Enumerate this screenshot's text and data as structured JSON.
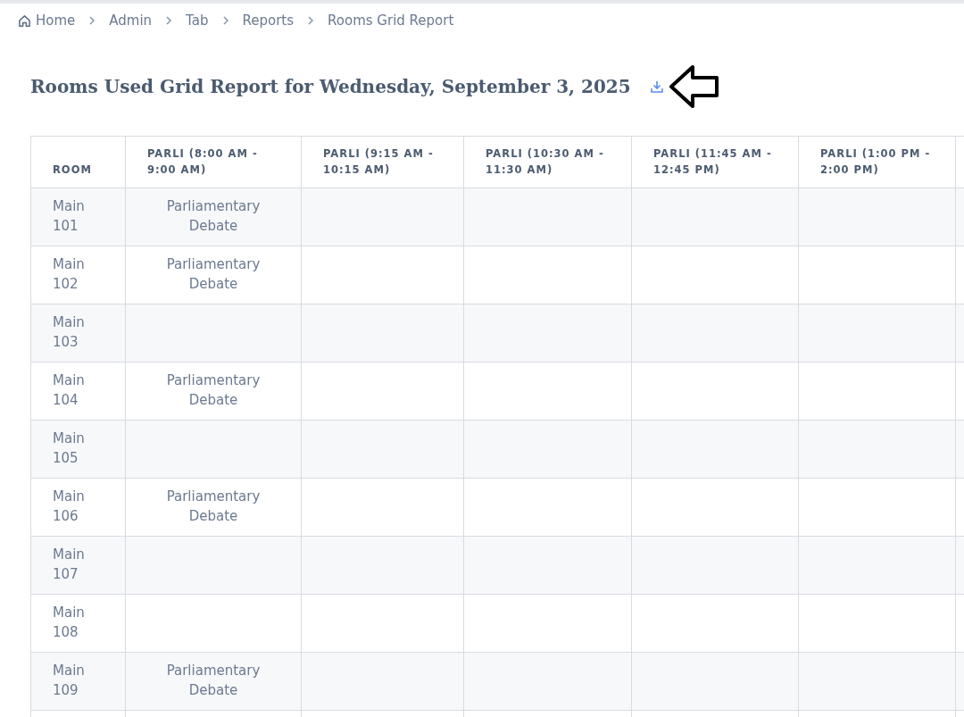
{
  "breadcrumb": [
    {
      "label": "Home",
      "kind": "home"
    },
    {
      "label": "Admin",
      "kind": "link"
    },
    {
      "label": "Tab",
      "kind": "link"
    },
    {
      "label": "Reports",
      "kind": "link"
    },
    {
      "label": "Rooms Grid Report",
      "kind": "current"
    }
  ],
  "title": "Rooms Used Grid Report for Wednesday, September 3, 2025",
  "table": {
    "columns": [
      "ROOM",
      "PARLI (8:00 AM - 9:00 AM)",
      "PARLI (9:15 AM - 10:15 AM)",
      "PARLI (10:30 AM - 11:30 AM)",
      "PARLI (11:45 AM - 12:45 PM)",
      "PARLI (1:00 PM - 2:00 PM)"
    ],
    "rows": [
      {
        "room": "Main 101",
        "cells": [
          "Parliamentary Debate"
        ]
      },
      {
        "room": "Main 102",
        "cells": [
          "Parliamentary Debate"
        ]
      },
      {
        "room": "Main 103"
      },
      {
        "room": "Main 104",
        "cells": [
          "Parliamentary Debate"
        ]
      },
      {
        "room": "Main 105"
      },
      {
        "room": "Main 106",
        "cells": [
          "Parliamentary Debate"
        ]
      },
      {
        "room": "Main 107"
      },
      {
        "room": "Main 108"
      },
      {
        "room": "Main 109",
        "cells": [
          "Parliamentary Debate"
        ]
      }
    ]
  }
}
